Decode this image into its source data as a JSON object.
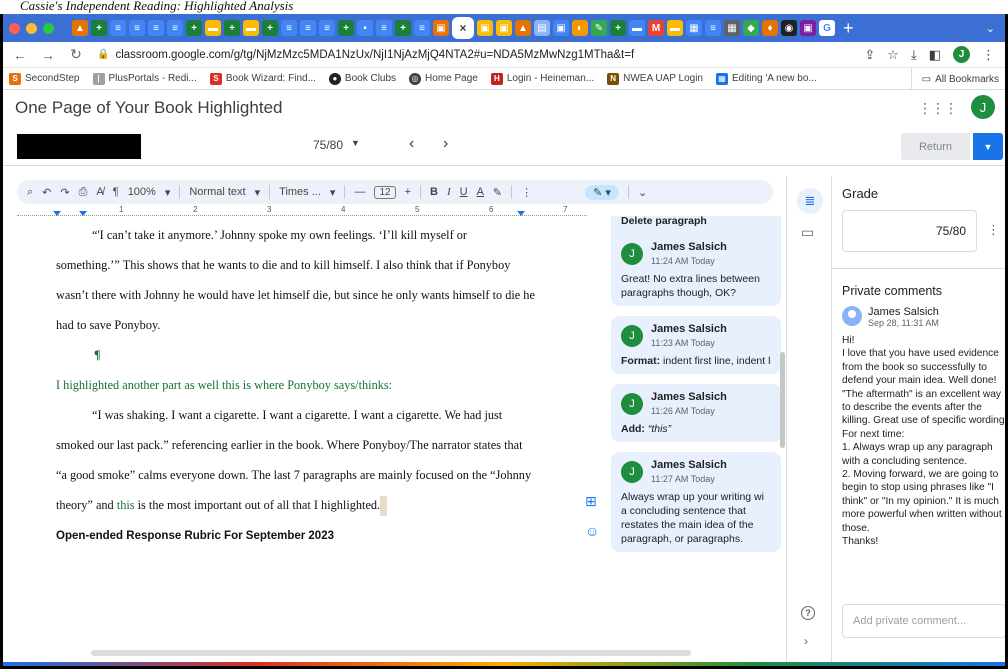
{
  "caption": "Cassie's Independent Reading: Highlighted Analysis",
  "browser": {
    "url": "classroom.google.com/g/tg/NjMzMzc5MDA1NzUx/NjI1NjAzMjQ4NTA2#u=NDA5MzMwNzg1MTha&t=f",
    "bookmarks": [
      "SecondStep",
      "PlusPortals - Redi...",
      "Book Wizard: Find...",
      "Book Clubs",
      "Home Page",
      "Login - Heineman...",
      "NWEA UAP Login",
      "Editing 'A new bo..."
    ],
    "all_bookmarks": "All Bookmarks",
    "profile_initial": "J"
  },
  "classroom": {
    "title": "One Page of Your Book Highlighted",
    "page_count": "75/80",
    "return_label": "Return",
    "user_initial": "J"
  },
  "docs_toolbar": {
    "zoom": "100%",
    "style": "Normal text",
    "font": "Times ...",
    "font_size": "12",
    "bold": "B",
    "italic": "I",
    "underline": "U",
    "text_color": "A"
  },
  "ruler": [
    "1",
    "2",
    "3",
    "4",
    "5",
    "6",
    "7"
  ],
  "doc": {
    "p1": "“'I can’t take it anymore.’ Johnny spoke my own feelings. ‘I’ll kill myself or",
    "p2": "something.’” This shows that he wants to die and to kill himself. I also think that if Ponyboy",
    "p3": "wasn’t there with Johnny he would have let himself die, but since he only wants himself to die he",
    "p4": "had to save Ponyboy.",
    "pilcrow": "¶",
    "p5": "I highlighted another part as well this is where Ponyboy says/thinks:",
    "p6": "“I was shaking. I want a cigarette. I want a cigarette. I want a cigarette. We had just",
    "p7": "smoked our last pack.” referencing earlier in the book. Where Ponyboy/The narrator states that",
    "p8": "“a good smoke” calms everyone down. The last 7 paragraphs are mainly focused on the “Johnny",
    "p9a": "theory” and ",
    "p9b": "this",
    "p9c": " is the most important out of all that I highlighted.",
    "rubric": "Open-ended Response Rubric For September 2023"
  },
  "comments": [
    {
      "head": "Delete paragraph"
    },
    {
      "author": "James Salsich",
      "time": "11:24 AM Today",
      "body": "Great! No extra lines between paragraphs though, OK?"
    },
    {
      "author": "James Salsich",
      "time": "11:23 AM Today",
      "label": "Format:",
      "body": "indent first line, indent le"
    },
    {
      "author": "James Salsich",
      "time": "11:26 AM Today",
      "label": "Add:",
      "body": "“this”"
    },
    {
      "author": "James Salsich",
      "time": "11:27 AM Today",
      "body": "Always wrap up your writing wi a concluding sentence that restates the main idea of the paragraph, or paragraphs."
    }
  ],
  "grade": {
    "title": "Grade",
    "value": "75/80"
  },
  "private_comments": {
    "title": "Private comments",
    "author": "James Salsich",
    "date": "Sep 28, 11:31 AM",
    "lines": [
      "Hi!",
      "I love that you have used evidence from the book so successfully to defend your main idea. Well done! \"The aftermath\" is an excellent way to describe the events after the killing. Great use of specific wording.",
      "For next time:",
      "1. Always wrap up any paragraph with a concluding sentence.",
      "2. Moving forward, we are going to begin to stop using phrases like \"I think\" or \"In my opinion.\" It is much more powerful when written without those.",
      "Thanks!"
    ],
    "placeholder": "Add private comment..."
  }
}
